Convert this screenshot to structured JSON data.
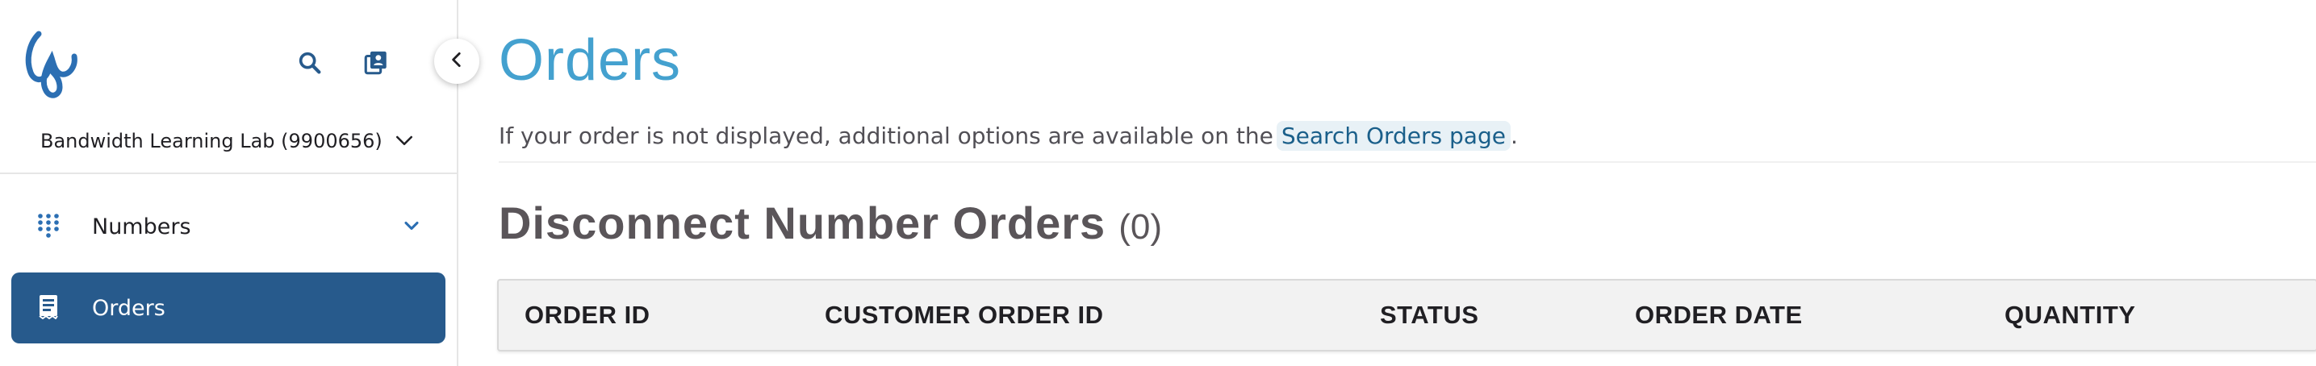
{
  "sidebar": {
    "account_label": "Bandwidth Learning Lab (9900656)",
    "items": [
      {
        "label": "Numbers",
        "icon": "dial-pad-icon"
      },
      {
        "label": "Orders",
        "icon": "receipt-icon",
        "active": true
      }
    ]
  },
  "main": {
    "title": "Orders",
    "info_text": "If your order is not displayed, additional options are available on the",
    "info_link": "Search Orders page",
    "info_suffix": ".",
    "section_title": "Disconnect Number Orders",
    "section_count": "(0)",
    "table": {
      "columns": [
        "ORDER ID",
        "CUSTOMER ORDER ID",
        "STATUS",
        "ORDER DATE",
        "QUANTITY"
      ]
    }
  },
  "colors": {
    "accent": "#44a1cf",
    "active_nav": "#275a8c",
    "logo": "#2c6fb3"
  }
}
